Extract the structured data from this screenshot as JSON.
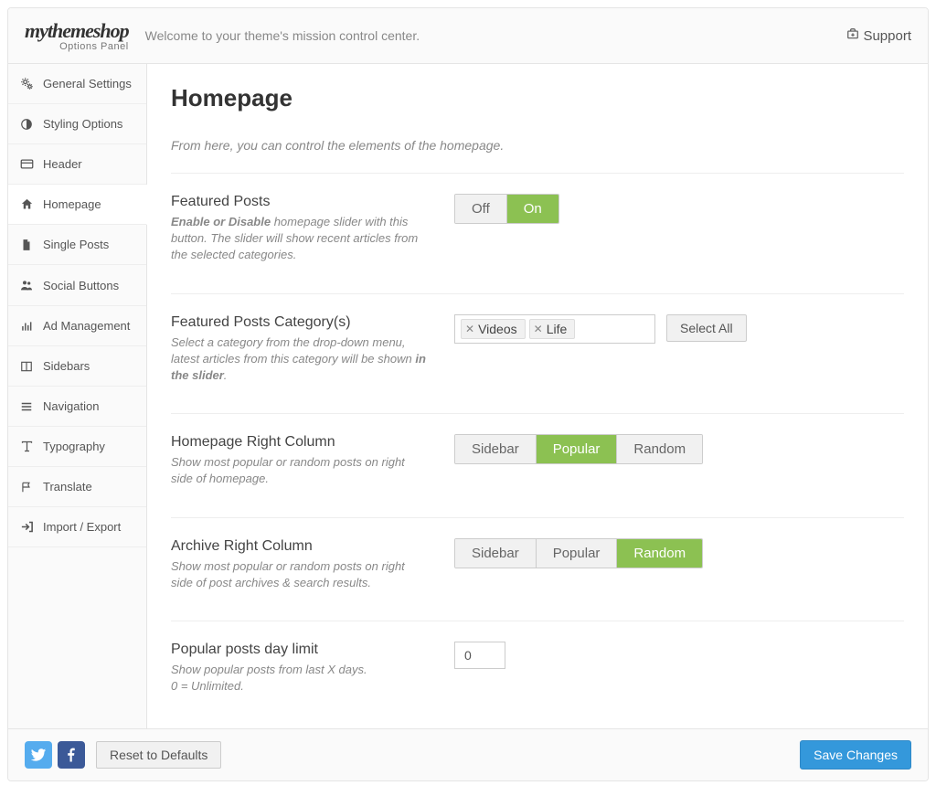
{
  "brand": {
    "name": "mythemeshop",
    "sub": "Options Panel"
  },
  "topbar": {
    "welcome": "Welcome to your theme's mission control center.",
    "support": "Support"
  },
  "sidebar": {
    "items": [
      {
        "label": "General Settings",
        "icon": "gears"
      },
      {
        "label": "Styling Options",
        "icon": "contrast"
      },
      {
        "label": "Header",
        "icon": "card"
      },
      {
        "label": "Homepage",
        "icon": "home",
        "active": true
      },
      {
        "label": "Single Posts",
        "icon": "file"
      },
      {
        "label": "Social Buttons",
        "icon": "users"
      },
      {
        "label": "Ad Management",
        "icon": "bars"
      },
      {
        "label": "Sidebars",
        "icon": "columns"
      },
      {
        "label": "Navigation",
        "icon": "menu"
      },
      {
        "label": "Typography",
        "icon": "type"
      },
      {
        "label": "Translate",
        "icon": "flag"
      },
      {
        "label": "Import / Export",
        "icon": "signin"
      }
    ]
  },
  "page": {
    "title": "Homepage",
    "desc": "From here, you can control the elements of the homepage."
  },
  "sections": {
    "featured": {
      "title": "Featured Posts",
      "desc_strong": "Enable or Disable",
      "desc_rest": " homepage slider with this button. The slider will show recent articles from the selected categories.",
      "off": "Off",
      "on": "On"
    },
    "categories": {
      "title": "Featured Posts Category(s)",
      "desc_a": "Select a category from the drop-down menu, latest articles from this category will be shown ",
      "desc_strong": "in the slider",
      "desc_b": ".",
      "tags": [
        "Videos",
        "Life"
      ],
      "select_all": "Select All"
    },
    "home_right": {
      "title": "Homepage Right Column",
      "desc": "Show most popular or random posts on right side of homepage.",
      "opts": [
        "Sidebar",
        "Popular",
        "Random"
      ],
      "active": 1
    },
    "archive_right": {
      "title": "Archive Right Column",
      "desc": "Show most popular or random posts on right side of post archives & search results.",
      "opts": [
        "Sidebar",
        "Popular",
        "Random"
      ],
      "active": 2
    },
    "popular_limit": {
      "title": "Popular posts day limit",
      "desc_a": "Show popular posts from last X days.",
      "desc_b": "0 = Unlimited.",
      "value": "0"
    }
  },
  "footer": {
    "reset": "Reset to Defaults",
    "save": "Save Changes"
  }
}
